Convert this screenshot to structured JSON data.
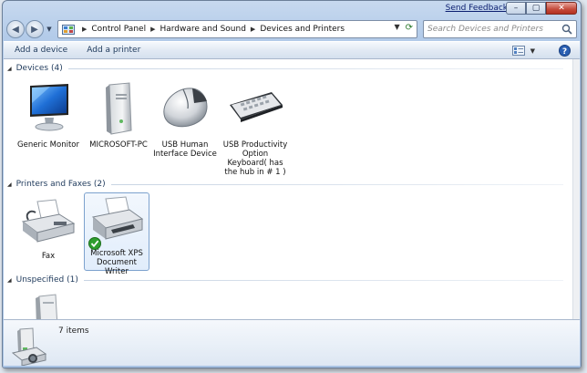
{
  "window": {
    "send_feedback": "Send Feedback",
    "caption": {
      "minimize": "–",
      "maximize": "▢",
      "close": "✕"
    }
  },
  "nav": {
    "back": "◀",
    "forward": "▶",
    "dropdown": "▼"
  },
  "address": {
    "breadcrumbs": [
      "Control Panel",
      "Hardware and Sound",
      "Devices and Printers"
    ],
    "dropdown": "▼",
    "refresh": "⟳"
  },
  "search": {
    "placeholder": "Search Devices and Printers"
  },
  "commands": {
    "add_device": "Add a device",
    "add_printer": "Add a printer",
    "views_dropdown": "▼"
  },
  "groups": {
    "devices": {
      "title": "Devices (4)",
      "items": [
        {
          "label": "Generic Monitor",
          "icon": "monitor-icon"
        },
        {
          "label": "MICROSOFT-PC",
          "icon": "computer-tower-icon"
        },
        {
          "label": "USB Human Interface Device",
          "icon": "mouse-icon"
        },
        {
          "label": "USB Productivity Option Keyboard( has the hub in # 1 )",
          "icon": "keyboard-icon"
        }
      ]
    },
    "printers": {
      "title": "Printers and Faxes (2)",
      "items": [
        {
          "label": "Fax",
          "icon": "fax-icon"
        },
        {
          "label": "Microsoft XPS Document Writer",
          "icon": "printer-icon",
          "default": true
        }
      ]
    },
    "unspecified": {
      "title": "Unspecified (1)",
      "items": [
        {
          "label": "",
          "icon": "unspecified-device-icon"
        }
      ]
    }
  },
  "status": {
    "count": "7 items"
  },
  "colors": {
    "link": "#0b1e6f",
    "command_text": "#1e395b",
    "selection_border": "#7da2ce",
    "default_check": "#2e9e2e"
  }
}
